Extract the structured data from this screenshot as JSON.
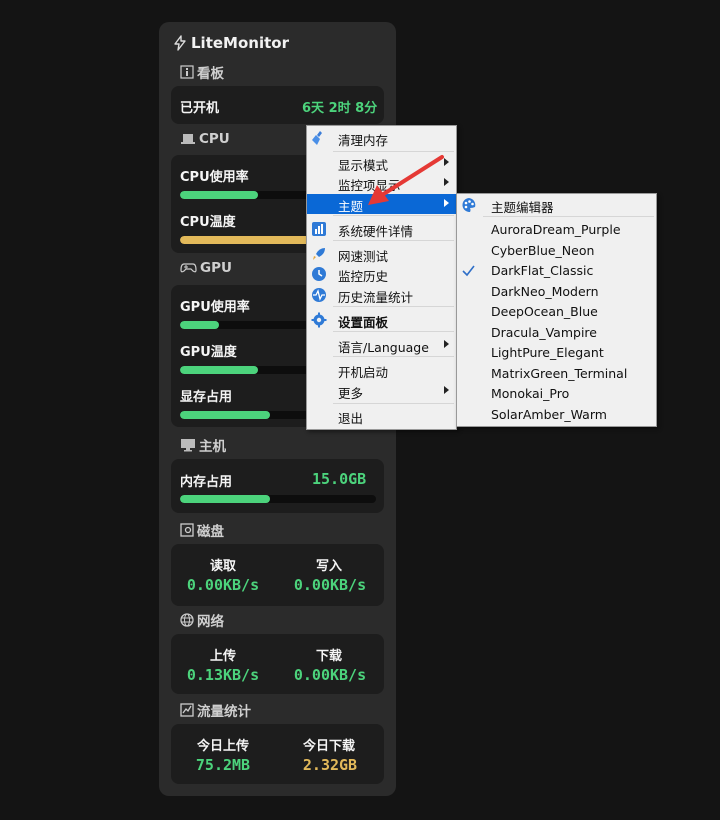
{
  "app": {
    "title": "LiteMonitor"
  },
  "dashboard": {
    "title": "看板",
    "uptime_label": "已开机",
    "uptime_value": "6天 2时 8分"
  },
  "cpu": {
    "title": "CPU",
    "usage_label": "CPU使用率",
    "usage_level": 0.4,
    "temp_label": "CPU温度",
    "temp_level": 0.7
  },
  "gpu": {
    "title": "GPU",
    "usage_label": "GPU使用率",
    "usage_level": 0.2,
    "temp_label": "GPU温度",
    "temp_level": 0.4,
    "vram_label": "显存占用",
    "vram_level": 0.46
  },
  "host": {
    "title": "主机",
    "mem_label": "内存占用",
    "mem_value": "15.0GB",
    "mem_level": 0.46
  },
  "disk": {
    "title": "磁盘",
    "read_label": "读取",
    "read_value": "0.00KB/s",
    "write_label": "写入",
    "write_value": "0.00KB/s"
  },
  "network": {
    "title": "网络",
    "up_label": "上传",
    "up_value": "0.13KB/s",
    "down_label": "下载",
    "down_value": "0.00KB/s"
  },
  "traffic": {
    "title": "流量统计",
    "today_up_label": "今日上传",
    "today_up_value": "75.2MB",
    "today_down_label": "今日下载",
    "today_down_value": "2.32GB"
  },
  "context_menu": {
    "items": [
      "清理内存",
      "显示模式",
      "监控项显示",
      "主题",
      "系统硬件详情",
      "网速测试",
      "监控历史",
      "历史流量统计",
      "设置面板",
      "语言/Language",
      "开机启动",
      "更多",
      "退出"
    ]
  },
  "theme_submenu": {
    "editor": "主题编辑器",
    "themes": [
      "AuroraDream_Purple",
      "CyberBlue_Neon",
      "DarkFlat_Classic",
      "DarkNeo_Modern",
      "DeepOcean_Blue",
      "Dracula_Vampire",
      "LightPure_Elegant",
      "MatrixGreen_Terminal",
      "Monokai_Pro",
      "SolarAmber_Warm"
    ],
    "checked": "DarkFlat_Classic"
  },
  "colors": {
    "green": "#4cd37c",
    "amber": "#e2b95a",
    "highlight": "#0a68d6",
    "annotation_arrow": "#e53935"
  }
}
